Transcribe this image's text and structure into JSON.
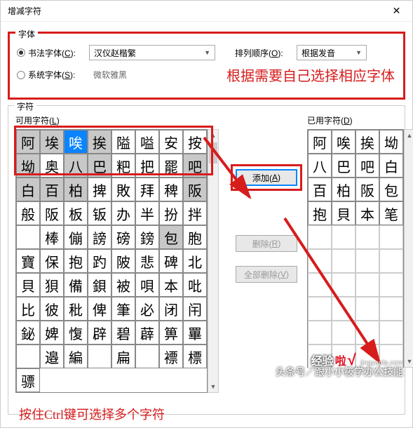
{
  "window": {
    "title": "增减字符",
    "close": "✕"
  },
  "font_group": {
    "legend": "字体",
    "calligraphy_label_pre": "书法字体(",
    "calligraphy_label_key": "C",
    "calligraphy_label_post": "):",
    "calligraphy_value": "汉仪赵楷繁",
    "system_label_pre": "系统字体(",
    "system_label_key": "S",
    "system_label_post": "):",
    "system_value": "微软雅黑",
    "sort_label_pre": "排列顺序(",
    "sort_label_key": "O",
    "sort_label_post": "):",
    "sort_value": "根据发音",
    "red_note": "根据需要自己选择相应字体"
  },
  "chars": {
    "legend": "字符",
    "available_label_pre": "可用字符(",
    "available_label_key": "L",
    "available_label_post": ")",
    "used_label_pre": "已用字符(",
    "used_label_key": "D",
    "used_label_post": ")",
    "grid_left": [
      {
        "t": "阿",
        "c": "hl"
      },
      {
        "t": "埃",
        "c": "hl"
      },
      {
        "t": "唉",
        "c": "sel"
      },
      {
        "t": "挨",
        "c": "hl"
      },
      {
        "t": "隘",
        "c": ""
      },
      {
        "t": "嗌",
        "c": ""
      },
      {
        "t": "安",
        "c": ""
      },
      {
        "t": "按",
        "c": ""
      },
      {
        "t": "坳",
        "c": "hl"
      },
      {
        "t": "奥",
        "c": ""
      },
      {
        "t": "八",
        "c": "hl"
      },
      {
        "t": "巴",
        "c": "hl"
      },
      {
        "t": "粑",
        "c": ""
      },
      {
        "t": "把",
        "c": ""
      },
      {
        "t": "罷",
        "c": ""
      },
      {
        "t": "吧",
        "c": "hl"
      },
      {
        "t": "白",
        "c": "hl"
      },
      {
        "t": "百",
        "c": "hl"
      },
      {
        "t": "柏",
        "c": "hl"
      },
      {
        "t": "捭",
        "c": ""
      },
      {
        "t": "敗",
        "c": ""
      },
      {
        "t": "拜",
        "c": ""
      },
      {
        "t": "稗",
        "c": ""
      },
      {
        "t": "阪",
        "c": "hl"
      },
      {
        "t": "般",
        "c": ""
      },
      {
        "t": "阪",
        "c": ""
      },
      {
        "t": "板",
        "c": ""
      },
      {
        "t": "钣",
        "c": ""
      },
      {
        "t": "办",
        "c": ""
      },
      {
        "t": "半",
        "c": ""
      },
      {
        "t": "扮",
        "c": ""
      },
      {
        "t": "拌",
        "c": ""
      },
      {
        "t": "",
        "c": ""
      },
      {
        "t": "棒",
        "c": ""
      },
      {
        "t": "傰",
        "c": ""
      },
      {
        "t": "謗",
        "c": ""
      },
      {
        "t": "磅",
        "c": ""
      },
      {
        "t": "鎊",
        "c": ""
      },
      {
        "t": "包",
        "c": "hl"
      },
      {
        "t": "胞",
        "c": ""
      },
      {
        "t": "寶",
        "c": ""
      }
    ],
    "grid_left_rest": [
      [
        "保",
        "抱",
        "趵",
        "陂",
        "悲",
        "碑",
        "北",
        "貝"
      ],
      [
        "狽",
        "備",
        "鋇",
        "被",
        "唄",
        "本",
        "吡",
        "比"
      ],
      [
        "彼",
        "秕",
        "俾",
        "筆",
        "必",
        "闭",
        "闬",
        "鉍"
      ],
      [
        "婢",
        "愎",
        "辟",
        "碧",
        "薜",
        "箅",
        "罼",
        "",
        ""
      ],
      [
        "邉",
        "編",
        "",
        "扁",
        "",
        "褾",
        "標",
        "骠"
      ]
    ],
    "grid_right": [
      [
        "阿",
        "唉",
        "挨",
        "坳"
      ],
      [
        "八",
        "巴",
        "吧",
        "白"
      ],
      [
        "百",
        "柏",
        "阪",
        "包"
      ],
      [
        "抱",
        "貝",
        "本",
        "笔"
      ]
    ],
    "buttons": {
      "add_pre": "添加(",
      "add_key": "A",
      "add_post": ")",
      "remove_pre": "删除(",
      "remove_key": "R",
      "remove_post": ")",
      "remove_all_pre": "全部删除(",
      "remove_all_key": "V",
      "remove_all_post": ")"
    }
  },
  "bottom_note": "按住Ctrl键可选择多个字符",
  "watermark": {
    "line1a": "经验",
    "line1b": "啦",
    "check": "√",
    "domain": "jingyanla.com",
    "line2": "头条号／跟小小筱学办公技能"
  },
  "colors": {
    "highlight": "#d71c1c",
    "selection": "#0a84ff"
  }
}
